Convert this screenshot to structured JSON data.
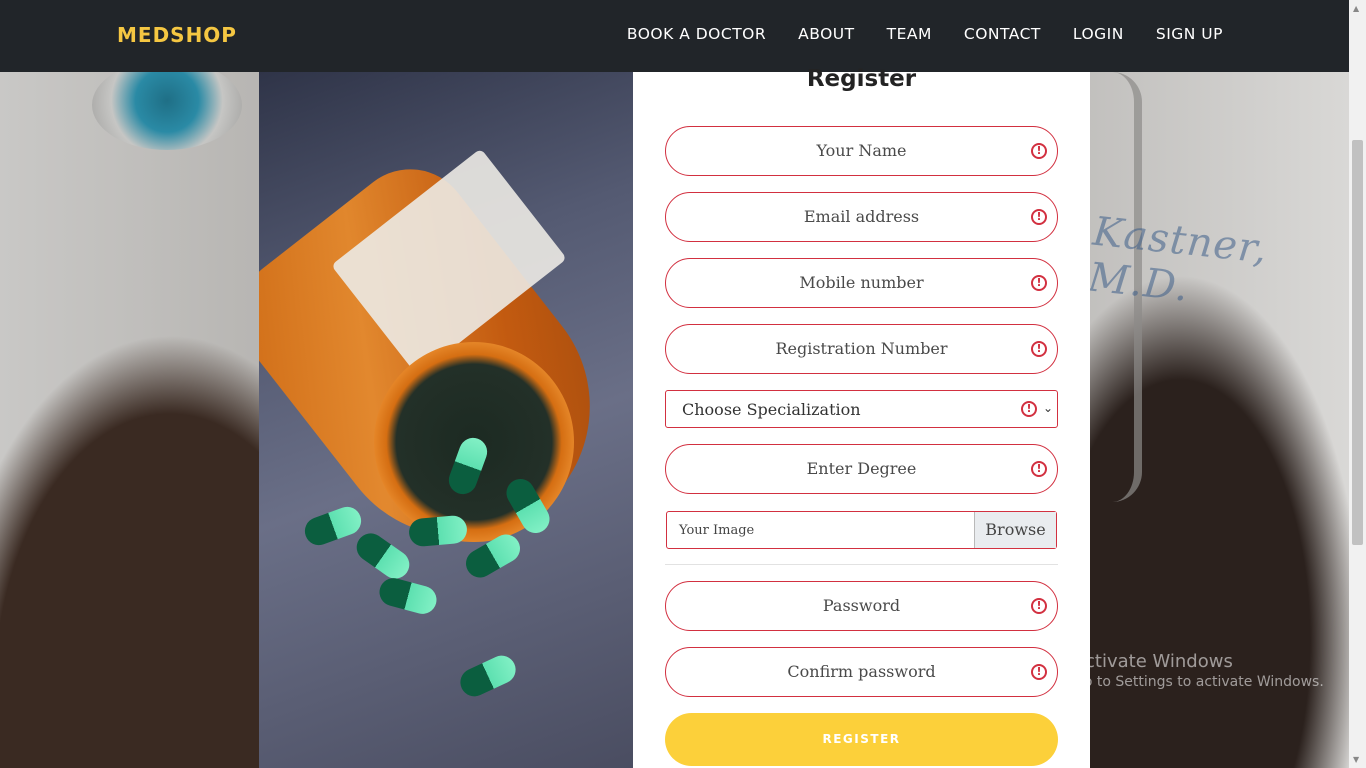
{
  "header": {
    "brand": "MEDSHOP",
    "nav": [
      {
        "label": "BOOK A DOCTOR"
      },
      {
        "label": "ABOUT"
      },
      {
        "label": "TEAM"
      },
      {
        "label": "CONTACT"
      },
      {
        "label": "LOGIN"
      },
      {
        "label": "SIGN UP"
      }
    ]
  },
  "background": {
    "coat_text": "Kastner, M.D."
  },
  "form": {
    "title": "Register",
    "name_placeholder": "Your Name",
    "email_placeholder": "Email address",
    "mobile_placeholder": "Mobile number",
    "registration_placeholder": "Registration Number",
    "specialization_selected": "Choose Specialization",
    "degree_placeholder": "Enter Degree",
    "image_label": "Your Image",
    "browse_label": "Browse",
    "password_placeholder": "Password",
    "confirm_password_placeholder": "Confirm password",
    "register_label": "REGISTER",
    "error_icon_glyph": "!",
    "chevron_glyph": "⌄"
  },
  "watermark": {
    "line1": "Activate Windows",
    "line2": "Go to Settings to activate Windows."
  },
  "colors": {
    "navbar_bg": "#212529",
    "brand": "#f5c742",
    "field_border": "#d23040",
    "button_bg": "#fcd03a"
  }
}
